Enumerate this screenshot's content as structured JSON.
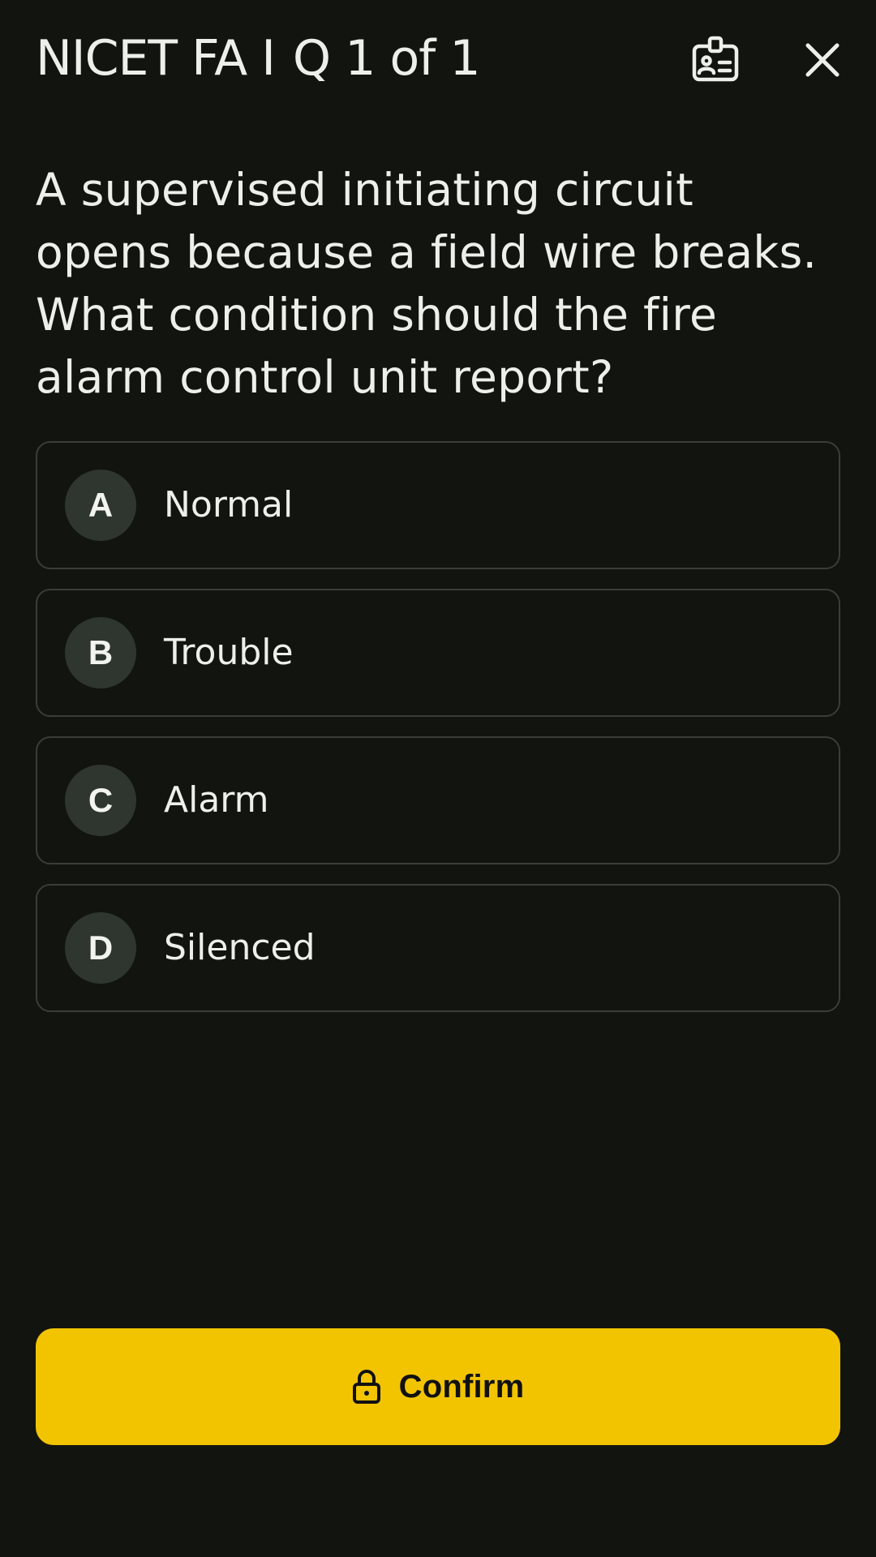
{
  "header": {
    "exam_name": "NICET FA I",
    "progress_label": "Q 1 of 1",
    "badge_icon": "id-badge-icon",
    "close_icon": "close-icon"
  },
  "question": {
    "text": "A supervised initiating circuit opens because a field wire breaks. What condition should the fire alarm control unit report?"
  },
  "options": [
    {
      "letter": "A",
      "text": "Normal"
    },
    {
      "letter": "B",
      "text": "Trouble"
    },
    {
      "letter": "C",
      "text": "Alarm"
    },
    {
      "letter": "D",
      "text": "Silenced"
    }
  ],
  "confirm": {
    "label": "Confirm",
    "icon": "lock-icon"
  },
  "colors": {
    "background": "#121410",
    "accent": "#F2C400",
    "option_border": "#3A3D38",
    "letter_circle": "#2F3630",
    "text": "#ECEFEA"
  }
}
